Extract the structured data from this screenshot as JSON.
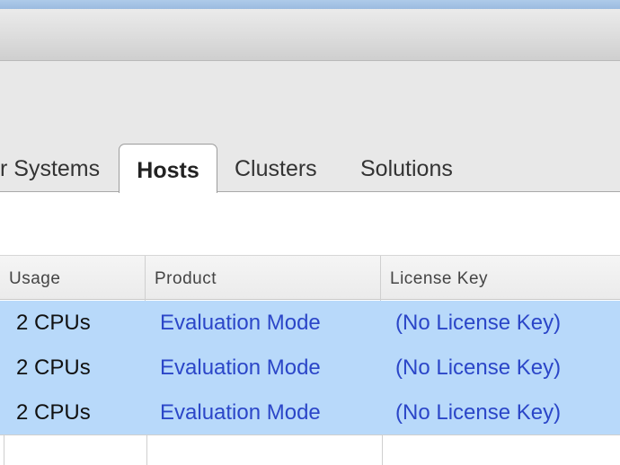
{
  "tabs": [
    {
      "label": "r Systems"
    },
    {
      "label": "Hosts",
      "active": true
    },
    {
      "label": "Clusters"
    },
    {
      "label": "Solutions"
    }
  ],
  "grid": {
    "columns": [
      "Usage",
      "Product",
      "License Key"
    ],
    "rows": [
      {
        "usage": "2 CPUs",
        "product": "Evaluation Mode",
        "license_key": "(No License Key)"
      },
      {
        "usage": "2 CPUs",
        "product": "Evaluation Mode",
        "license_key": "(No License Key)"
      },
      {
        "usage": "2 CPUs",
        "product": "Evaluation Mode",
        "license_key": "(No License Key)"
      }
    ]
  },
  "colors": {
    "selected_row": "#b8d9fa",
    "link_text": "#2b46c8"
  }
}
